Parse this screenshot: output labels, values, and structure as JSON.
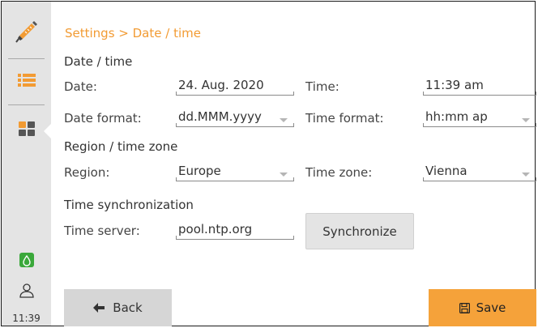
{
  "sidebar": {
    "items": [
      {
        "icon": "tool-icon"
      },
      {
        "icon": "list-icon"
      },
      {
        "icon": "grid-icon"
      },
      {
        "icon": "battery-icon"
      },
      {
        "icon": "user-icon"
      }
    ],
    "clock": "11:39"
  },
  "breadcrumb": "Settings > Date / time",
  "sections": {
    "datetime": "Date / time",
    "region": "Region / time zone",
    "sync": "Time synchronization"
  },
  "fields": {
    "date": {
      "label": "Date:",
      "value": "24. Aug. 2020"
    },
    "time": {
      "label": "Time:",
      "value": "11:39 am"
    },
    "date_format": {
      "label": "Date format:",
      "value": "dd.MMM.yyyy"
    },
    "time_format": {
      "label": "Time format:",
      "value": "hh:mm ap"
    },
    "region": {
      "label": "Region:",
      "value": "Europe"
    },
    "time_zone": {
      "label": "Time zone:",
      "value": "Vienna"
    },
    "time_server": {
      "label": "Time server:",
      "value": "pool.ntp.org"
    }
  },
  "buttons": {
    "synchronize": "Synchronize",
    "back": "Back",
    "save": "Save"
  },
  "colors": {
    "accent": "#f29b33",
    "save": "#f5a23a",
    "sidebar": "#e4e4e4",
    "active_icon": "#f29b33",
    "battery": "#3aa83a"
  }
}
